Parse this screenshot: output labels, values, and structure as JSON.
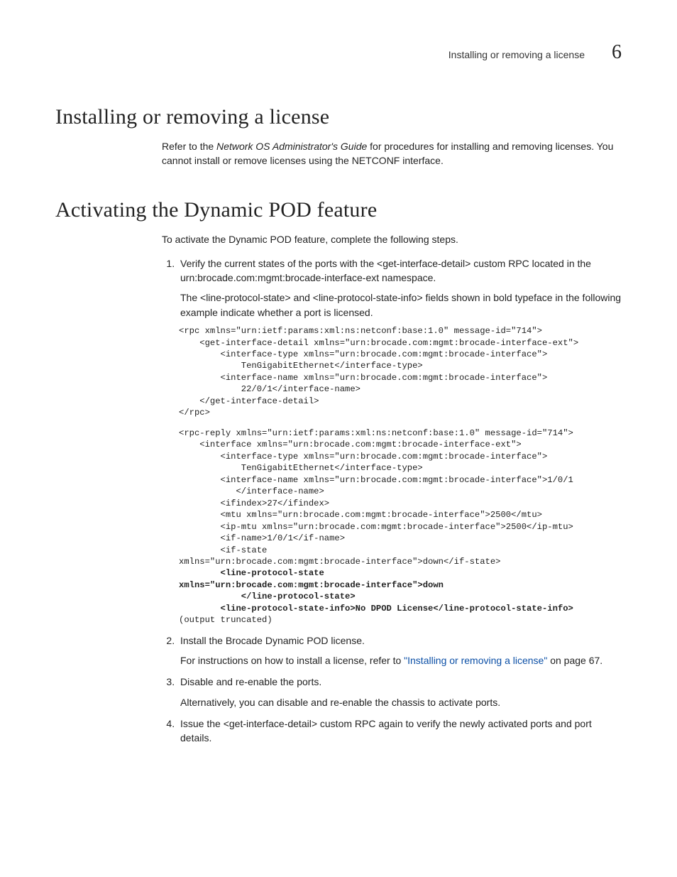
{
  "header": {
    "runningTitle": "Installing or removing a license",
    "chapterNumber": "6"
  },
  "section1": {
    "title": "Installing or removing a license",
    "para1_a": "Refer to the ",
    "para1_em": "Network OS Administrator's Guide",
    "para1_b": " for procedures for installing and removing licenses. You cannot install or remove licenses using the NETCONF interface."
  },
  "section2": {
    "title": "Activating the Dynamic POD feature",
    "intro": "To activate the Dynamic POD feature, complete the following steps.",
    "step1": {
      "text": "Verify the current states of the ports with the <get-interface-detail> custom RPC located in the urn:brocade.com:mgmt:brocade-interface-ext namespace.",
      "note": "The <line-protocol-state> and <line-protocol-state-info> fields shown in bold typeface in the following example indicate whether a port is licensed.",
      "code1": "<rpc xmlns=\"urn:ietf:params:xml:ns:netconf:base:1.0\" message-id=\"714\">\n    <get-interface-detail xmlns=\"urn:brocade.com:mgmt:brocade-interface-ext\">\n        <interface-type xmlns=\"urn:brocade.com:mgmt:brocade-interface\">\n            TenGigabitEthernet</interface-type>\n        <interface-name xmlns=\"urn:brocade.com:mgmt:brocade-interface\">\n            22/0/1</interface-name>\n    </get-interface-detail>\n</rpc>",
      "code2a": "<rpc-reply xmlns=\"urn:ietf:params:xml:ns:netconf:base:1.0\" message-id=\"714\">\n    <interface xmlns=\"urn:brocade.com:mgmt:brocade-interface-ext\">\n        <interface-type xmlns=\"urn:brocade.com:mgmt:brocade-interface\">\n            TenGigabitEthernet</interface-type>\n        <interface-name xmlns=\"urn:brocade.com:mgmt:brocade-interface\">1/0/1\n           </interface-name>\n        <ifindex>27</ifindex>\n        <mtu xmlns=\"urn:brocade.com:mgmt:brocade-interface\">2500</mtu>\n        <ip-mtu xmlns=\"urn:brocade.com:mgmt:brocade-interface\">2500</ip-mtu>\n        <if-name>1/0/1</if-name>\n        <if-state \nxmlns=\"urn:brocade.com:mgmt:brocade-interface\">down</if-state>",
      "code2b": "        <line-protocol-state \nxmlns=\"urn:brocade.com:mgmt:brocade-interface\">down\n            </line-protocol-state>\n        <line-protocol-state-info>No DPOD License</line-protocol-state-info>",
      "code2c": "(output truncated)"
    },
    "step2": {
      "text": "Install the Brocade Dynamic POD license.",
      "instr_a": "For instructions on how to install a license, refer to ",
      "link": "\"Installing or removing a license\"",
      "instr_b": " on page 67."
    },
    "step3": {
      "text": "Disable and re-enable the ports.",
      "alt": "Alternatively, you can disable and re-enable the chassis to activate ports."
    },
    "step4": {
      "text": "Issue the <get-interface-detail> custom RPC again to verify the newly activated ports and port details."
    }
  }
}
